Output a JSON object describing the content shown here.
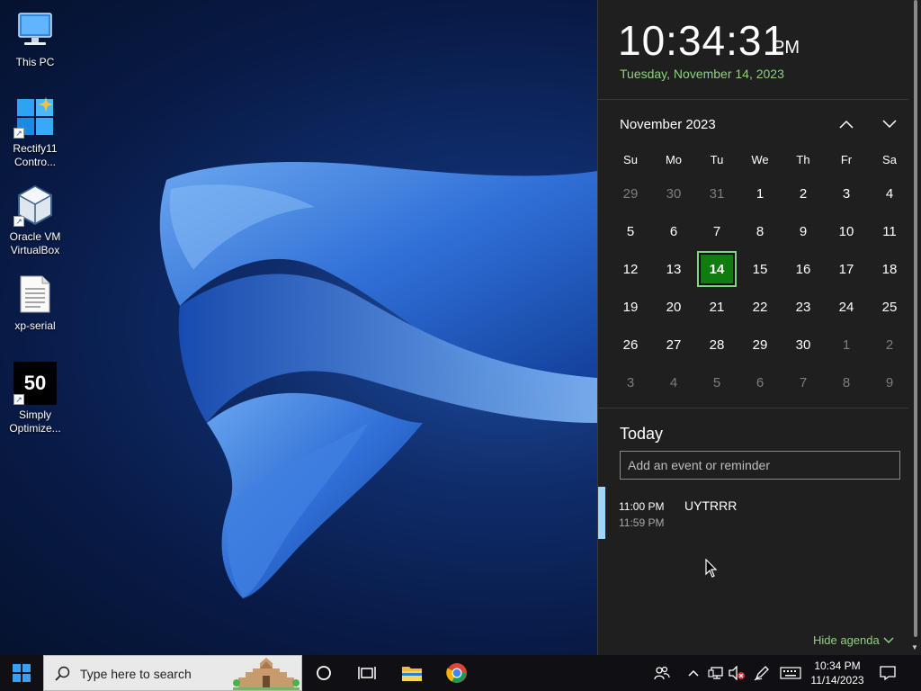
{
  "desktop": {
    "icons": [
      {
        "label": "This PC",
        "icon": "computer-icon"
      },
      {
        "label": "Rectify11 Contro...",
        "icon": "rectify11-icon"
      },
      {
        "label": "Oracle VM VirtualBox",
        "icon": "virtualbox-icon"
      },
      {
        "label": "xp-serial",
        "icon": "text-file-icon"
      },
      {
        "label": "Simply Optimize...",
        "icon": "simply-optimizer-icon",
        "badge": "50"
      }
    ]
  },
  "flyout": {
    "time": "10:34:31",
    "ampm": "PM",
    "date": "Tuesday, November 14, 2023",
    "month_title": "November 2023",
    "weekdays": [
      "Su",
      "Mo",
      "Tu",
      "We",
      "Th",
      "Fr",
      "Sa"
    ],
    "weeks": [
      [
        {
          "d": "29",
          "o": true
        },
        {
          "d": "30",
          "o": true
        },
        {
          "d": "31",
          "o": true
        },
        {
          "d": "1"
        },
        {
          "d": "2"
        },
        {
          "d": "3"
        },
        {
          "d": "4"
        }
      ],
      [
        {
          "d": "5"
        },
        {
          "d": "6"
        },
        {
          "d": "7"
        },
        {
          "d": "8"
        },
        {
          "d": "9"
        },
        {
          "d": "10"
        },
        {
          "d": "11"
        }
      ],
      [
        {
          "d": "12"
        },
        {
          "d": "13"
        },
        {
          "d": "14",
          "today": true
        },
        {
          "d": "15"
        },
        {
          "d": "16"
        },
        {
          "d": "17"
        },
        {
          "d": "18"
        }
      ],
      [
        {
          "d": "19"
        },
        {
          "d": "20"
        },
        {
          "d": "21"
        },
        {
          "d": "22"
        },
        {
          "d": "23"
        },
        {
          "d": "24"
        },
        {
          "d": "25"
        }
      ],
      [
        {
          "d": "26"
        },
        {
          "d": "27"
        },
        {
          "d": "28"
        },
        {
          "d": "29"
        },
        {
          "d": "30"
        },
        {
          "d": "1",
          "o": true
        },
        {
          "d": "2",
          "o": true
        }
      ],
      [
        {
          "d": "3",
          "o": true
        },
        {
          "d": "4",
          "o": true
        },
        {
          "d": "5",
          "o": true
        },
        {
          "d": "6",
          "o": true
        },
        {
          "d": "7",
          "o": true
        },
        {
          "d": "8",
          "o": true
        },
        {
          "d": "9",
          "o": true
        }
      ]
    ],
    "today_header": "Today",
    "event_placeholder": "Add an event or reminder",
    "event": {
      "start": "11:00 PM",
      "end": "11:59 PM",
      "title": "UYTRRR"
    },
    "hide_agenda": "Hide agenda"
  },
  "taskbar": {
    "search_placeholder": "Type here to search",
    "pinned": [
      "cortana-icon",
      "task-view-icon",
      "file-explorer-icon",
      "chrome-icon"
    ],
    "tray_time": "10:34 PM",
    "tray_date": "11/14/2023"
  },
  "colors": {
    "accent_green": "#107c10",
    "date_green": "#8fd17f",
    "flyout_bg": "#1f1f1f",
    "event_bar": "#9fd6ff"
  }
}
